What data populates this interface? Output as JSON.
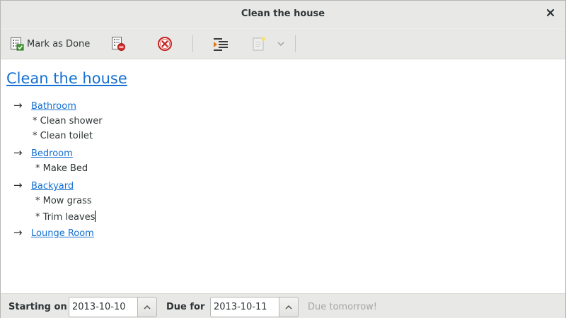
{
  "window": {
    "title": "Clean the house"
  },
  "toolbar": {
    "mark_done_label": "Mark as Done"
  },
  "document": {
    "title": "Clean the house",
    "sections": [
      {
        "heading": "Bathroom",
        "items": [
          "* Clean shower",
          "* Clean toilet"
        ]
      },
      {
        "heading": "Bedroom",
        "items": [
          "* Make Bed"
        ]
      },
      {
        "heading": "Backyard",
        "items": [
          "* Mow grass",
          "* Trim leaves"
        ]
      },
      {
        "heading": "Lounge Room",
        "items": []
      }
    ]
  },
  "statusbar": {
    "start_label": "Starting on",
    "start_value": "2013-10-10",
    "due_label": "Due for",
    "due_value": "2013-10-11",
    "due_note": "Due tomorrow!"
  },
  "colors": {
    "link": "#1570d1",
    "chrome": "#e8e8e7",
    "muted": "#a6a8a4"
  }
}
